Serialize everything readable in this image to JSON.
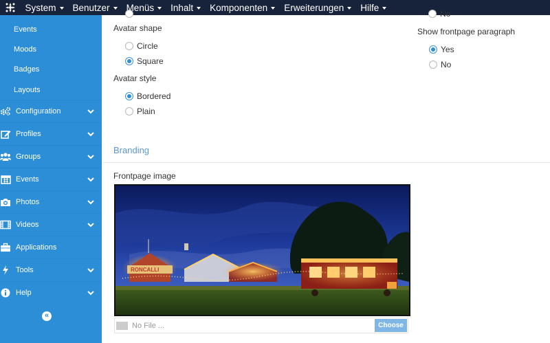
{
  "topbar": {
    "menu": [
      {
        "label": "System"
      },
      {
        "label": "Benutzer"
      },
      {
        "label": "Menüs"
      },
      {
        "label": "Inhalt"
      },
      {
        "label": "Komponenten"
      },
      {
        "label": "Erweiterungen"
      },
      {
        "label": "Hilfe"
      }
    ]
  },
  "sidebar": {
    "sub_items": [
      "Events",
      "Moods",
      "Badges",
      "Layouts"
    ],
    "items": [
      {
        "label": "Configuration",
        "icon": "gears-icon",
        "expandable": true
      },
      {
        "label": "Profiles",
        "icon": "edit-icon",
        "expandable": true
      },
      {
        "label": "Groups",
        "icon": "users-icon",
        "expandable": true
      },
      {
        "label": "Events",
        "icon": "calendar-icon",
        "expandable": true
      },
      {
        "label": "Photos",
        "icon": "camera-icon",
        "expandable": true
      },
      {
        "label": "Videos",
        "icon": "film-icon",
        "expandable": true
      },
      {
        "label": "Applications",
        "icon": "briefcase-icon",
        "expandable": false
      },
      {
        "label": "Tools",
        "icon": "bolt-icon",
        "expandable": true
      },
      {
        "label": "Help",
        "icon": "info-icon",
        "expandable": true
      }
    ],
    "collapse_glyph": "«"
  },
  "main": {
    "partial_option": "No",
    "avatar_shape": {
      "label": "Avatar shape",
      "options": [
        "Circle",
        "Square"
      ],
      "selected": "Square"
    },
    "avatar_style": {
      "label": "Avatar style",
      "options": [
        "Bordered",
        "Plain"
      ],
      "selected": "Bordered"
    },
    "frontpage_paragraph": {
      "label": "Show frontpage paragraph",
      "options": [
        "Yes",
        "No"
      ],
      "selected": "Yes"
    },
    "branding": {
      "title": "Branding",
      "image_label": "Frontpage image",
      "sign_text": "RONCALLI",
      "file_placeholder": "No File ...",
      "choose_label": "Choose"
    }
  },
  "colors": {
    "topbar": "#17223b",
    "sidebar": "#2d8ed8",
    "accent": "#5a97d1",
    "choose_button": "#7fb6e5"
  }
}
